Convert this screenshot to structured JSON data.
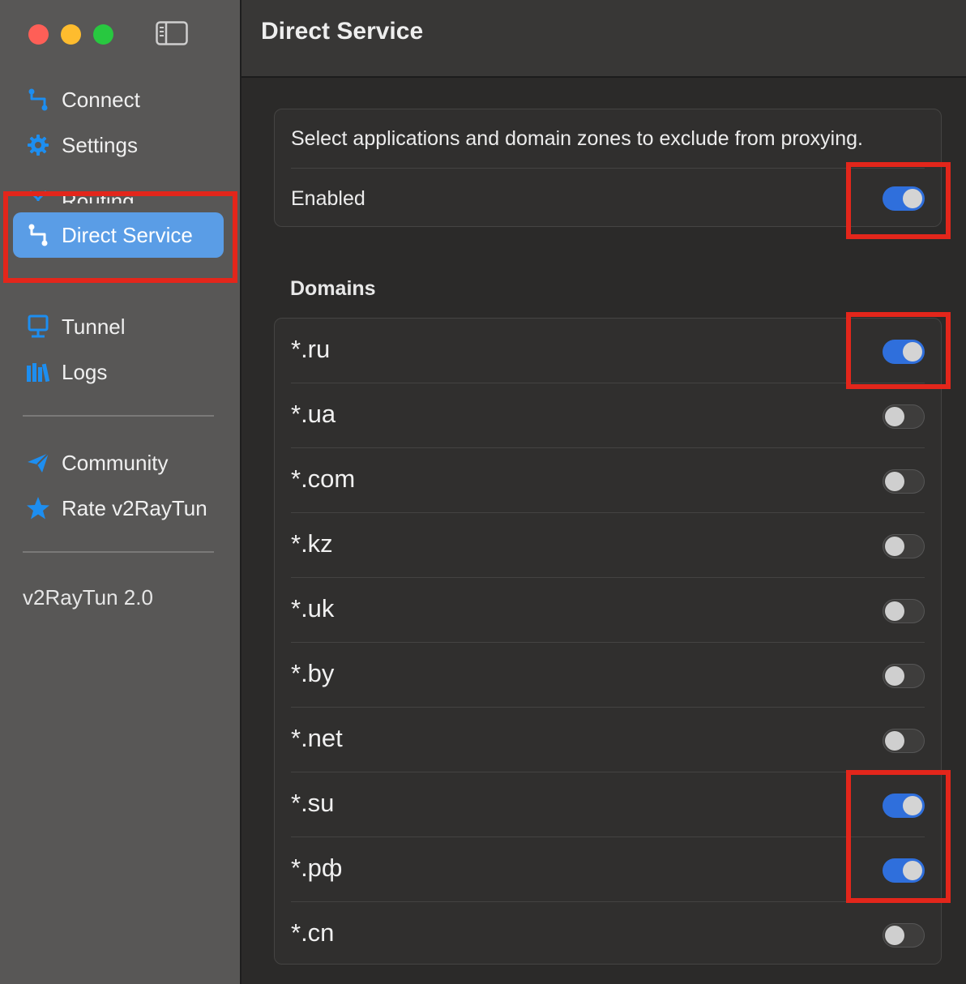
{
  "sidebar": {
    "items": [
      {
        "label": "Connect",
        "icon": "route-icon"
      },
      {
        "label": "Settings",
        "icon": "gear-icon"
      },
      {
        "label": "Routing",
        "icon": "routing-icon"
      },
      {
        "label": "Direct Service",
        "icon": "route-icon",
        "active": true
      },
      {
        "label": "Tunnel",
        "icon": "monitor-icon"
      },
      {
        "label": "Logs",
        "icon": "books-icon"
      },
      {
        "label": "Community",
        "icon": "paper-plane-icon"
      },
      {
        "label": "Rate v2RayTun",
        "icon": "star-icon"
      }
    ],
    "version": "v2RayTun 2.0"
  },
  "header": {
    "title": "Direct Service"
  },
  "main": {
    "description": "Select applications and domain zones to exclude from proxying.",
    "enabled_label": "Enabled",
    "enabled": true,
    "domains_title": "Domains",
    "domains": [
      {
        "label": "*.ru",
        "on": true
      },
      {
        "label": "*.ua",
        "on": false
      },
      {
        "label": "*.com",
        "on": false
      },
      {
        "label": "*.kz",
        "on": false
      },
      {
        "label": "*.uk",
        "on": false
      },
      {
        "label": "*.by",
        "on": false
      },
      {
        "label": "*.net",
        "on": false
      },
      {
        "label": "*.su",
        "on": true
      },
      {
        "label": "*.рф",
        "on": true
      },
      {
        "label": "*.cn",
        "on": false
      }
    ]
  },
  "colors": {
    "accent": "#2f6fdc",
    "sidebar_active": "#5a9de6",
    "highlight": "#e3261b",
    "icon_blue": "#1d8ef0"
  }
}
